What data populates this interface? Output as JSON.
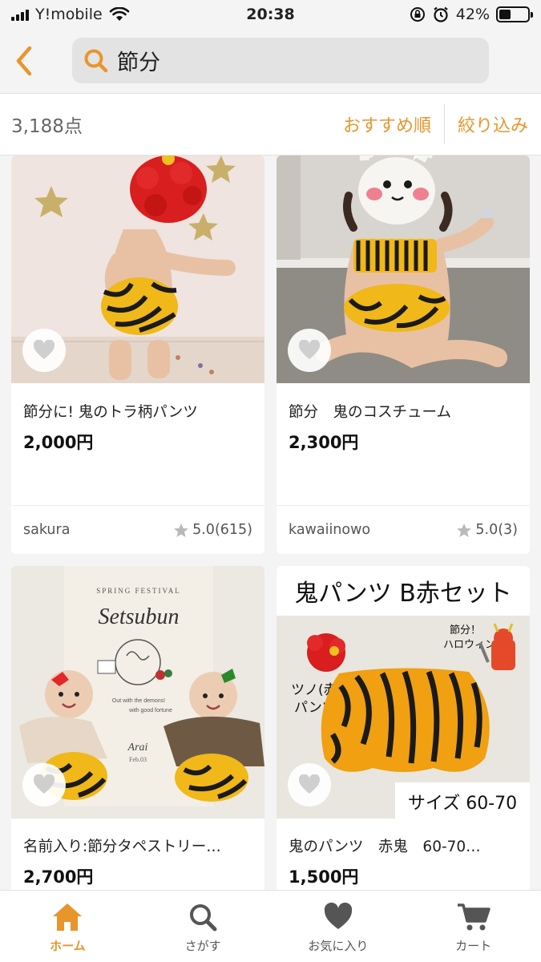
{
  "status_bar": {
    "carrier": "Y!mobile",
    "time": "20:38",
    "battery": "42%",
    "battery_level": 0.42
  },
  "search": {
    "query": "節分"
  },
  "results": {
    "count": "3,188点",
    "sort_label": "おすすめ順",
    "filter_label": "絞り込み"
  },
  "products": [
    {
      "title": "節分に! 鬼のトラ柄パンツ",
      "price": "2,000円",
      "seller": "sakura",
      "rating": "5.0(615)"
    },
    {
      "title": "節分　鬼のコスチューム",
      "price": "2,300円",
      "seller": "kawaiinowo",
      "rating": "5.0(3)"
    },
    {
      "title": "名前入り:節分タペストリー…",
      "price": "2,700円",
      "image_text": {
        "header": "SPRING FESTIVAL",
        "title": "Setsubun",
        "caption1": "Out with the demons!",
        "caption2": "with good fortune",
        "name": "Arai",
        "date": "Feb.03"
      }
    },
    {
      "title": "鬼のパンツ　赤鬼　60-70…",
      "price": "1,500円",
      "image_text": {
        "banner": "鬼パンツ  B赤セット",
        "horn_label_1": "ツノ(赤)",
        "horn_label_2": "パンツ",
        "note_1": "節分！",
        "note_2": "ハロウィン",
        "size": "サイズ  60-70"
      }
    }
  ],
  "tabs": [
    {
      "label": "ホーム",
      "icon": "home-icon"
    },
    {
      "label": "さがす",
      "icon": "search-icon"
    },
    {
      "label": "お気に入り",
      "icon": "heart-icon"
    },
    {
      "label": "カート",
      "icon": "cart-icon"
    }
  ],
  "colors": {
    "accent": "#e8952c",
    "background": "#f4f4f4"
  }
}
